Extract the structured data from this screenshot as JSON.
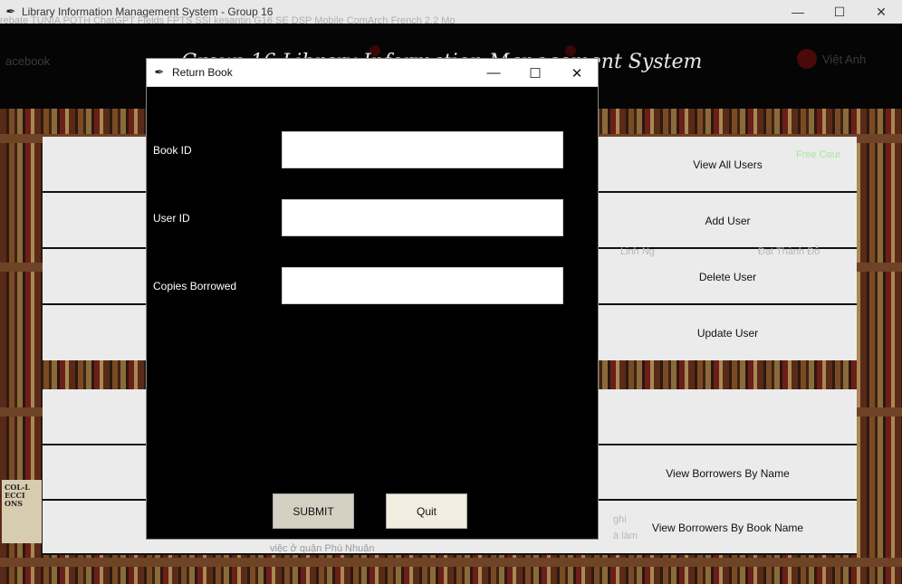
{
  "main_window": {
    "title": "Library Information Management System - Group 16",
    "minimize_glyph": "—",
    "maximize_glyph": "☐",
    "close_glyph": "✕",
    "heading": "Group 16 Library Information Management System",
    "background_bookmarks": "rebate   TUNIA   POTH   ChatGPT   Fields   FPTS   SSI   kesantin   G16   SE   DSP   Mobile   ComArch   French 2.2   Mo",
    "background_left_text": "acebook",
    "background_right_text": "Việt Anh",
    "book_spine_text": "COL-L ECCI ONS"
  },
  "menu": {
    "view_all_users": "View All Users",
    "add_user": "Add User",
    "delete_user": "Delete User",
    "update_user": "Update User",
    "view_borrowers_by_name": "View Borrowers By Name",
    "view_borrowers_by_book_name": "View Borrowers By Book Name"
  },
  "background_ghost": {
    "free_course": "Free Cour",
    "name_left": "Linh Ng",
    "name_right": "Đạt Thành Đỗ",
    "bottom_text": "việc ở quận Phú Nhuận",
    "bottom_right": "à làm",
    "bottom_right2": "ghi"
  },
  "dialog": {
    "title": "Return Book",
    "minimize_glyph": "—",
    "maximize_glyph": "☐",
    "close_glyph": "✕",
    "fields": [
      {
        "label": "Book ID",
        "value": ""
      },
      {
        "label": "User ID",
        "value": ""
      },
      {
        "label": "Copies Borrowed",
        "value": ""
      }
    ],
    "submit_label": "SUBMIT",
    "quit_label": "Quit"
  }
}
